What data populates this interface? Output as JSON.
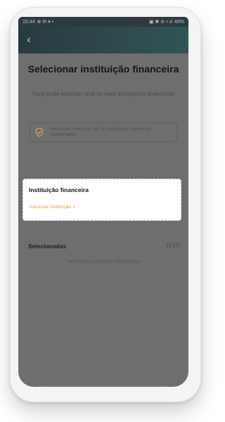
{
  "status_bar": {
    "time": "15:44",
    "left_icons": "⊕ ✉ ▾ •",
    "right_icons": "▣ ✱ ⊘ ▿.ıl",
    "battery": "48%"
  },
  "header": {
    "back_icon": "‹"
  },
  "page": {
    "title": "Selecionar instituição financeira",
    "subtitle": "Você pode autorizar uma ou mais instituições financeiras"
  },
  "info_box": {
    "icon": "shield-check-icon",
    "text": "Você pode relacionar até 10 instituições financeiras credenciadas."
  },
  "institution_card": {
    "title": "Instituição financeira",
    "add_link": "Adicionar instituição +"
  },
  "selected": {
    "label": "Selecionadas",
    "count": "0/10",
    "empty_text": "Nenhuma instituição selecionada"
  },
  "footer": {
    "button_label": ""
  },
  "colors": {
    "header_dark": "#283a40",
    "link_gold": "#d9a13b",
    "overlay_gray": "#6e6e6e"
  }
}
